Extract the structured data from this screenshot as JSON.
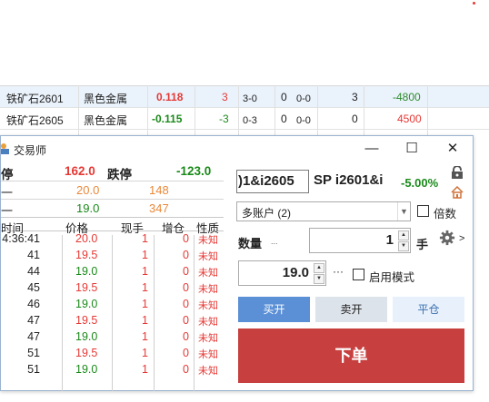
{
  "background_table": {
    "rows": [
      {
        "name": "铁矿石2601",
        "category": "黑色金属",
        "price": "0.118",
        "price_color": "#e53935",
        "change": "3",
        "change_color": "#e53935",
        "a": "3-0",
        "b": "0",
        "c": "0-0",
        "d": "3",
        "pnl": "-4800",
        "pnl_color": "#2e8b2e",
        "selected": true
      },
      {
        "name": "铁矿石2605",
        "category": "黑色金属",
        "price": "-0.115",
        "price_color": "#1a8a1a",
        "change": "-3",
        "change_color": "#1a8a1a",
        "a": "0-3",
        "b": "0",
        "c": "0-0",
        "d": "0",
        "pnl": "4500",
        "pnl_color": "#e53935",
        "selected": false
      }
    ]
  },
  "window": {
    "title": "交易师",
    "controls": {
      "minimize": "—",
      "maximize": "☐",
      "close": "✕"
    }
  },
  "quote": {
    "limit_up_label": "停",
    "limit_up_value": "162.0",
    "limit_down_label": "跌停",
    "limit_down_value": "-123.0",
    "ask": {
      "label": "一",
      "price": "20.0",
      "volume": "148"
    },
    "bid": {
      "label": "一",
      "price": "19.0",
      "volume": "347"
    }
  },
  "ticks": {
    "headers": [
      "时间",
      "价格",
      "现手",
      "增仓",
      "性质"
    ],
    "rows": [
      {
        "time": "4:36:41",
        "price": "20.0",
        "price_color": "#e53935",
        "hand": "1",
        "inc": "0",
        "nature": "未知"
      },
      {
        "time": "41",
        "price": "19.5",
        "price_color": "#e53935",
        "hand": "1",
        "inc": "0",
        "nature": "未知"
      },
      {
        "time": "44",
        "price": "19.0",
        "price_color": "#1a8a1a",
        "hand": "1",
        "inc": "0",
        "nature": "未知"
      },
      {
        "time": "45",
        "price": "19.5",
        "price_color": "#e53935",
        "hand": "1",
        "inc": "0",
        "nature": "未知"
      },
      {
        "time": "46",
        "price": "19.0",
        "price_color": "#1a8a1a",
        "hand": "1",
        "inc": "0",
        "nature": "未知"
      },
      {
        "time": "47",
        "price": "19.5",
        "price_color": "#e53935",
        "hand": "1",
        "inc": "0",
        "nature": "未知"
      },
      {
        "time": "47",
        "price": "19.0",
        "price_color": "#1a8a1a",
        "hand": "1",
        "inc": "0",
        "nature": "未知"
      },
      {
        "time": "51",
        "price": "19.5",
        "price_color": "#e53935",
        "hand": "1",
        "inc": "0",
        "nature": "未知"
      },
      {
        "time": "51",
        "price": "19.0",
        "price_color": "#1a8a1a",
        "hand": "1",
        "inc": "0",
        "nature": "未知"
      }
    ]
  },
  "order": {
    "code_value": ")1&i2605",
    "contract_name": "SP i2601&i",
    "change_pct": "-5.00%",
    "account": "多账户 (2)",
    "multiplier_label": "倍数",
    "qty_label": "数量",
    "qty_hint": "...",
    "qty_value": "1",
    "unit": "手",
    "more": ">",
    "price_value": "19.0",
    "price_more": "···",
    "enable_mode_label": "启用模式",
    "buy_open": "买开",
    "sell_open": "卖开",
    "close_pos": "平仓",
    "submit": "下单"
  },
  "colors": {
    "up": "#e53935",
    "down": "#1a8a1a",
    "buy_btn": "#5b8fd6",
    "sell_btn": "#dde3ea",
    "close_btn": "#e8f1fb",
    "submit_btn": "#c7403f"
  },
  "icons": [
    "lock-icon",
    "house-icon",
    "gear-icon",
    "app-icon"
  ]
}
